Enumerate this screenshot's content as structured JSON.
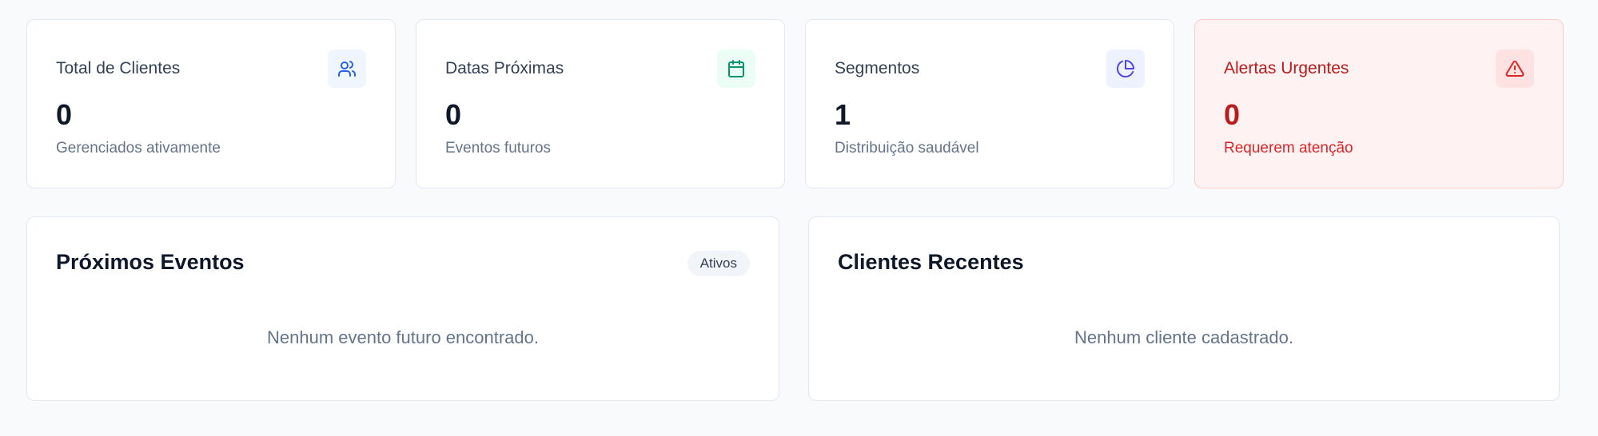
{
  "stats": [
    {
      "title": "Total de Clientes",
      "value": "0",
      "subtitle": "Gerenciados ativamente",
      "icon": "users-icon",
      "color": "#2563eb"
    },
    {
      "title": "Datas Próximas",
      "value": "0",
      "subtitle": "Eventos futuros",
      "icon": "calendar-icon",
      "color": "#059669"
    },
    {
      "title": "Segmentos",
      "value": "1",
      "subtitle": "Distribuição saudável",
      "icon": "pie-chart-icon",
      "color": "#4f46e5"
    },
    {
      "title": "Alertas Urgentes",
      "value": "0",
      "subtitle": "Requerem atenção",
      "icon": "alert-triangle-icon",
      "color": "#dc2626"
    }
  ],
  "events_panel": {
    "title": "Próximos Eventos",
    "badge": "Ativos",
    "empty_message": "Nenhum evento futuro encontrado."
  },
  "clients_panel": {
    "title": "Clientes Recentes",
    "empty_message": "Nenhum cliente cadastrado."
  }
}
